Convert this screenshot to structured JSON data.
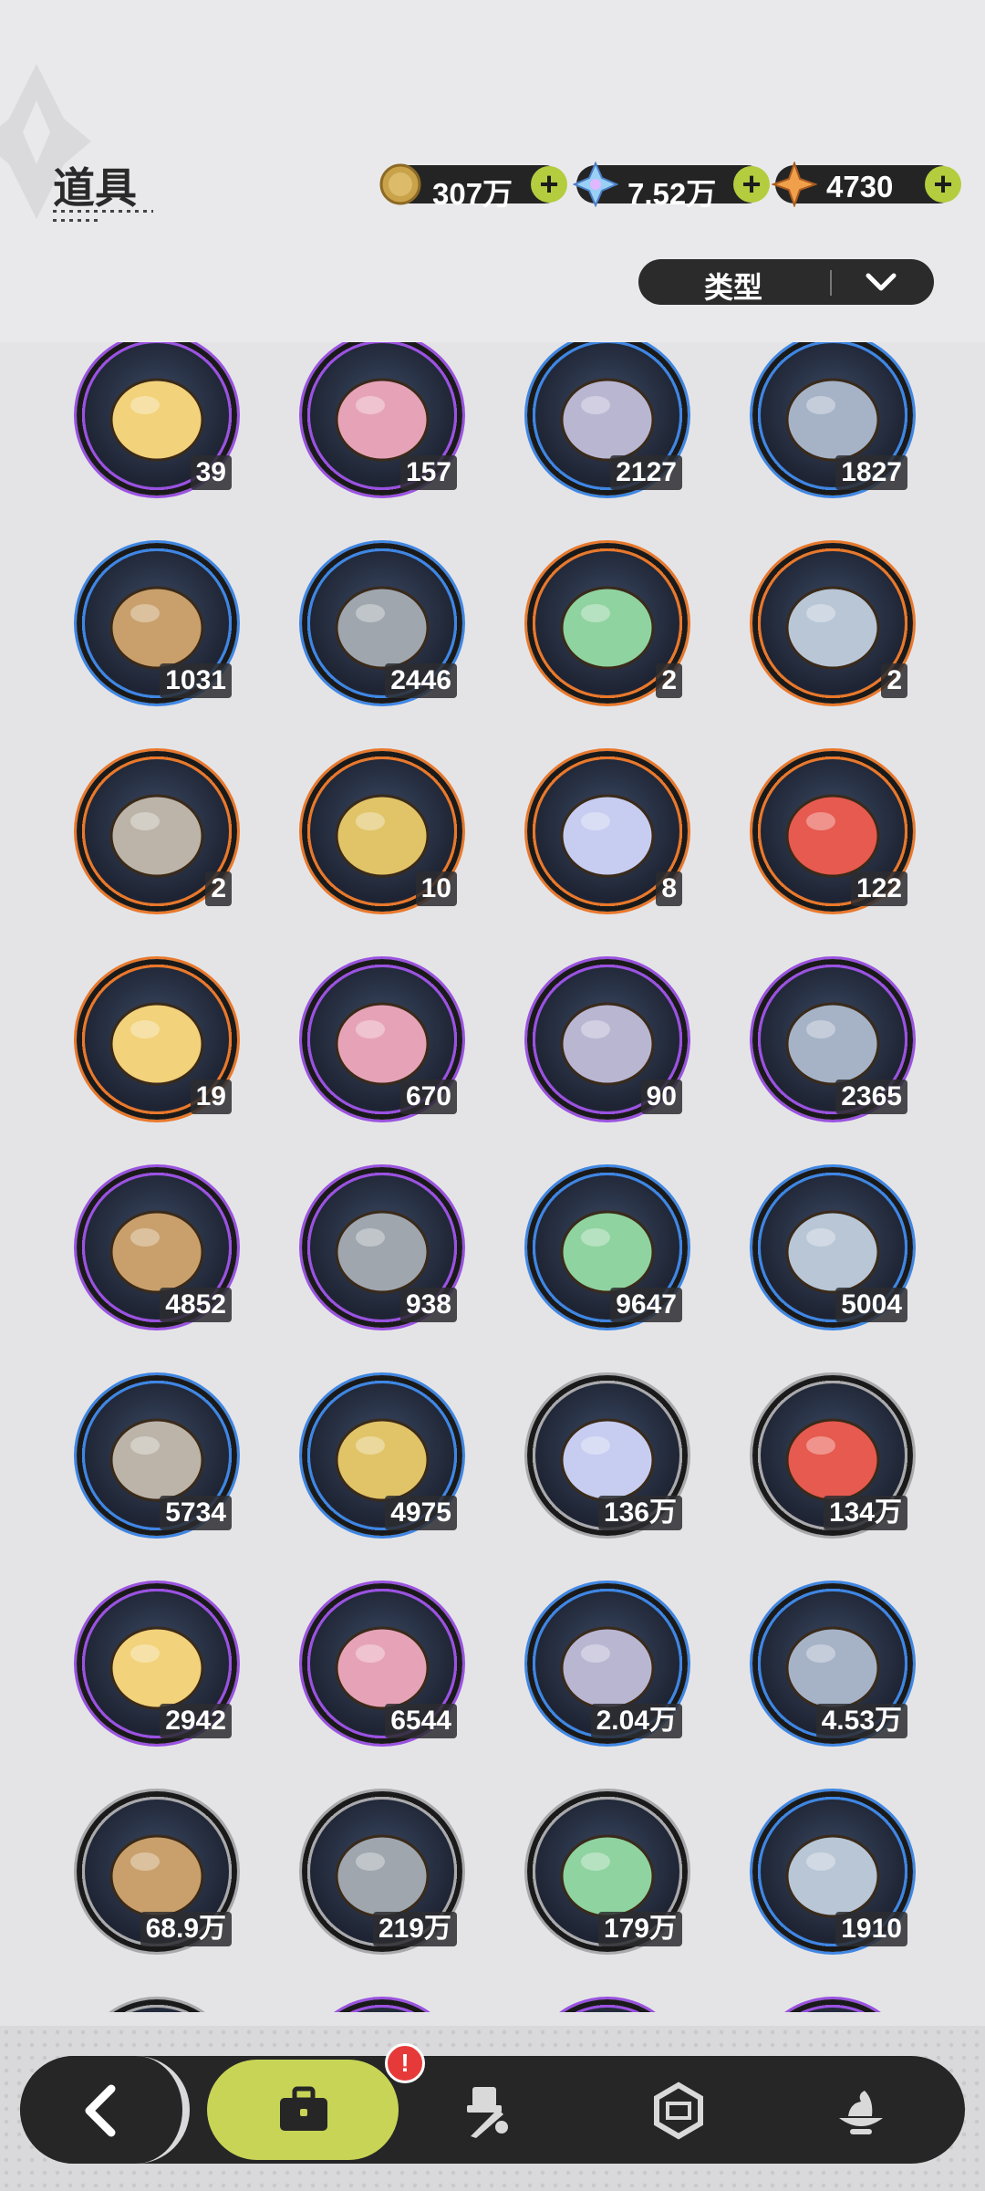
{
  "header": {
    "title": "道具",
    "filter_label": "类型"
  },
  "currencies": [
    {
      "name": "gold-coin-icon",
      "value": "307万"
    },
    {
      "name": "crystal-gem-icon",
      "value": "7.52万"
    },
    {
      "name": "star-shard-icon",
      "value": "4730"
    }
  ],
  "items": [
    {
      "icon": "scroll-icon",
      "rarity": "purple",
      "count": "39"
    },
    {
      "icon": "peach-icon",
      "rarity": "purple",
      "count": "157"
    },
    {
      "icon": "sword-icon",
      "rarity": "blue",
      "count": "2127"
    },
    {
      "icon": "gauntlet-icon",
      "rarity": "blue",
      "count": "1827"
    },
    {
      "icon": "pickaxe-icon",
      "rarity": "blue",
      "count": "1031"
    },
    {
      "icon": "hammer-icon",
      "rarity": "blue",
      "count": "2446"
    },
    {
      "icon": "jade-cloud-icon",
      "rarity": "orange",
      "count": "2"
    },
    {
      "icon": "spiked-ball-icon",
      "rarity": "orange",
      "count": "2"
    },
    {
      "icon": "drill-icon",
      "rarity": "orange",
      "count": "2"
    },
    {
      "icon": "golden-key-icon",
      "rarity": "orange",
      "count": "10"
    },
    {
      "icon": "outfit-coin-icon",
      "rarity": "orange",
      "count": "8"
    },
    {
      "icon": "wheel-ticket-icon",
      "rarity": "orange",
      "count": "122"
    },
    {
      "icon": "rainbow-ticket-icon",
      "rarity": "orange",
      "count": "19"
    },
    {
      "icon": "flower-coin-icon",
      "rarity": "purple",
      "count": "670"
    },
    {
      "icon": "moon-star-icon",
      "rarity": "purple",
      "count": "90"
    },
    {
      "icon": "fist-coin-icon",
      "rarity": "purple",
      "count": "2365"
    },
    {
      "icon": "blue-rune-coin-icon",
      "rarity": "purple",
      "count": "4852"
    },
    {
      "icon": "heart-coin-icon",
      "rarity": "purple",
      "count": "938"
    },
    {
      "icon": "fang-blade-icon",
      "rarity": "blue",
      "count": "9647"
    },
    {
      "icon": "dragon-scale-icon",
      "rarity": "blue",
      "count": "5004"
    },
    {
      "icon": "gear-icon",
      "rarity": "blue",
      "count": "5734"
    },
    {
      "icon": "leaf-icon",
      "rarity": "blue",
      "count": "4975"
    },
    {
      "icon": "wood-logs-icon",
      "rarity": "gray",
      "count": "136万"
    },
    {
      "icon": "stone-bricks-icon",
      "rarity": "gray",
      "count": "134万"
    },
    {
      "icon": "gold-ore-icon",
      "rarity": "purple",
      "count": "2942"
    },
    {
      "icon": "gold-crystal-icon",
      "rarity": "purple",
      "count": "6544"
    },
    {
      "icon": "gold-sand-icon",
      "rarity": "blue",
      "count": "2.04万"
    },
    {
      "icon": "red-crystal-icon",
      "rarity": "blue",
      "count": "4.53万"
    },
    {
      "icon": "sand-pile-icon",
      "rarity": "gray",
      "count": "68.9万"
    },
    {
      "icon": "dark-crystal-icon",
      "rarity": "gray",
      "count": "219万"
    },
    {
      "icon": "purple-orb-icon",
      "rarity": "gray",
      "count": "179万"
    },
    {
      "icon": "pet-food-bag-icon",
      "rarity": "blue",
      "count": "1910"
    },
    {
      "icon": "bowl-icon",
      "rarity": "gray",
      "count": ""
    },
    {
      "icon": "egg-icon",
      "rarity": "purple",
      "count": ""
    },
    {
      "icon": "wood-item-icon",
      "rarity": "purple",
      "count": ""
    },
    {
      "icon": "bottle-icon",
      "rarity": "purple",
      "count": ""
    }
  ],
  "nav": {
    "badge": "!"
  },
  "colors": {
    "purple": "#9a52e0",
    "blue": "#3f86e3",
    "orange": "#e8782c",
    "gray": "#a9a9ac"
  }
}
